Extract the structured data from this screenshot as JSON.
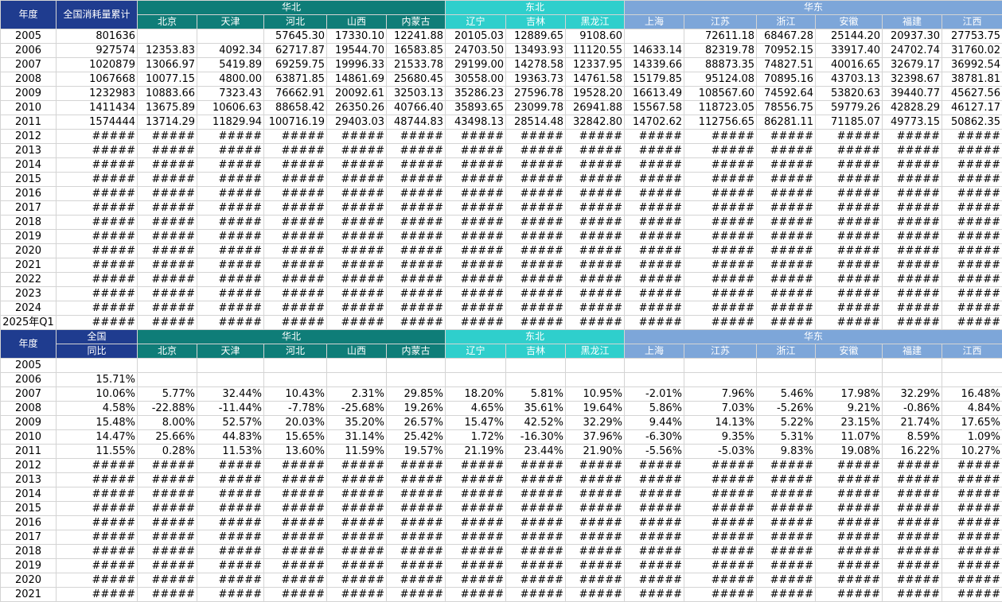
{
  "sheet": {
    "top_left_header": "年度",
    "nat_header_top": "全国消耗量累计",
    "nat_header_bottom_1": "全国",
    "nat_header_bottom_2": "同比",
    "regions": [
      {
        "name": "华北",
        "color": "#0f7d78",
        "span": 5
      },
      {
        "name": "东北",
        "color": "#2fcfcc",
        "span": 3
      },
      {
        "name": "华东",
        "color": "#7da6d9",
        "span": 7
      }
    ],
    "provinces": [
      "北京",
      "天津",
      "河北",
      "山西",
      "内蒙古",
      "辽宁",
      "吉林",
      "黑龙江",
      "上海",
      "江苏",
      "浙江",
      "安徽",
      "福建",
      "江西"
    ],
    "top_rows": [
      {
        "year": "2005",
        "values": [
          "801636",
          "",
          "",
          "57645.30",
          "17330.10",
          "12241.88",
          "20105.03",
          "12889.65",
          "9108.60",
          "",
          "72611.18",
          "68467.28",
          "25144.20",
          "20937.30",
          "27753.75"
        ]
      },
      {
        "year": "2006",
        "values": [
          "927574",
          "12353.83",
          "4092.34",
          "62717.87",
          "19544.70",
          "16583.85",
          "24703.50",
          "13493.93",
          "11120.55",
          "14633.14",
          "82319.78",
          "70952.15",
          "33917.40",
          "24702.74",
          "31760.02"
        ]
      },
      {
        "year": "2007",
        "values": [
          "1020879",
          "13066.97",
          "5419.89",
          "69259.75",
          "19996.33",
          "21533.78",
          "29199.00",
          "14278.58",
          "12337.95",
          "14339.66",
          "88873.35",
          "74827.51",
          "40016.65",
          "32679.17",
          "36992.54"
        ]
      },
      {
        "year": "2008",
        "values": [
          "1067668",
          "10077.15",
          "4800.00",
          "63871.85",
          "14861.69",
          "25680.45",
          "30558.00",
          "19363.73",
          "14761.58",
          "15179.85",
          "95124.08",
          "70895.16",
          "43703.13",
          "32398.67",
          "38781.81"
        ]
      },
      {
        "year": "2009",
        "values": [
          "1232983",
          "10883.66",
          "7323.43",
          "76662.91",
          "20092.61",
          "32503.13",
          "35286.23",
          "27596.78",
          "19528.20",
          "16613.49",
          "108567.60",
          "74592.64",
          "53820.63",
          "39440.77",
          "45627.56"
        ]
      },
      {
        "year": "2010",
        "values": [
          "1411434",
          "13675.89",
          "10606.63",
          "88658.42",
          "26350.26",
          "40766.40",
          "35893.65",
          "23099.78",
          "26941.88",
          "15567.58",
          "118723.05",
          "78556.75",
          "59779.26",
          "42828.29",
          "46127.17"
        ]
      },
      {
        "year": "2011",
        "values": [
          "1574444",
          "13714.29",
          "11829.94",
          "100716.19",
          "29403.03",
          "48744.83",
          "43498.13",
          "28514.48",
          "32842.80",
          "14702.62",
          "112756.65",
          "86281.11",
          "71185.07",
          "49773.15",
          "50862.35"
        ]
      },
      {
        "year": "2012",
        "values": [
          "#####",
          "#####",
          "#####",
          "#####",
          "#####",
          "#####",
          "#####",
          "#####",
          "#####",
          "#####",
          "#####",
          "#####",
          "#####",
          "#####",
          "#####"
        ]
      },
      {
        "year": "2013",
        "values": [
          "#####",
          "#####",
          "#####",
          "#####",
          "#####",
          "#####",
          "#####",
          "#####",
          "#####",
          "#####",
          "#####",
          "#####",
          "#####",
          "#####",
          "#####"
        ]
      },
      {
        "year": "2014",
        "values": [
          "#####",
          "#####",
          "#####",
          "#####",
          "#####",
          "#####",
          "#####",
          "#####",
          "#####",
          "#####",
          "#####",
          "#####",
          "#####",
          "#####",
          "#####"
        ]
      },
      {
        "year": "2015",
        "values": [
          "#####",
          "#####",
          "#####",
          "#####",
          "#####",
          "#####",
          "#####",
          "#####",
          "#####",
          "#####",
          "#####",
          "#####",
          "#####",
          "#####",
          "#####"
        ]
      },
      {
        "year": "2016",
        "values": [
          "#####",
          "#####",
          "#####",
          "#####",
          "#####",
          "#####",
          "#####",
          "#####",
          "#####",
          "#####",
          "#####",
          "#####",
          "#####",
          "#####",
          "#####"
        ]
      },
      {
        "year": "2017",
        "values": [
          "#####",
          "#####",
          "#####",
          "#####",
          "#####",
          "#####",
          "#####",
          "#####",
          "#####",
          "#####",
          "#####",
          "#####",
          "#####",
          "#####",
          "#####"
        ]
      },
      {
        "year": "2018",
        "values": [
          "#####",
          "#####",
          "#####",
          "#####",
          "#####",
          "#####",
          "#####",
          "#####",
          "#####",
          "#####",
          "#####",
          "#####",
          "#####",
          "#####",
          "#####"
        ]
      },
      {
        "year": "2019",
        "values": [
          "#####",
          "#####",
          "#####",
          "#####",
          "#####",
          "#####",
          "#####",
          "#####",
          "#####",
          "#####",
          "#####",
          "#####",
          "#####",
          "#####",
          "#####"
        ]
      },
      {
        "year": "2020",
        "values": [
          "#####",
          "#####",
          "#####",
          "#####",
          "#####",
          "#####",
          "#####",
          "#####",
          "#####",
          "#####",
          "#####",
          "#####",
          "#####",
          "#####",
          "#####"
        ]
      },
      {
        "year": "2021",
        "values": [
          "#####",
          "#####",
          "#####",
          "#####",
          "#####",
          "#####",
          "#####",
          "#####",
          "#####",
          "#####",
          "#####",
          "#####",
          "#####",
          "#####",
          "#####"
        ]
      },
      {
        "year": "2022",
        "values": [
          "#####",
          "#####",
          "#####",
          "#####",
          "#####",
          "#####",
          "#####",
          "#####",
          "#####",
          "#####",
          "#####",
          "#####",
          "#####",
          "#####",
          "#####"
        ]
      },
      {
        "year": "2023",
        "values": [
          "#####",
          "#####",
          "#####",
          "#####",
          "#####",
          "#####",
          "#####",
          "#####",
          "#####",
          "#####",
          "#####",
          "#####",
          "#####",
          "#####",
          "#####"
        ]
      },
      {
        "year": "2024",
        "values": [
          "#####",
          "#####",
          "#####",
          "#####",
          "#####",
          "#####",
          "#####",
          "#####",
          "#####",
          "#####",
          "#####",
          "#####",
          "#####",
          "#####",
          "#####"
        ]
      },
      {
        "year": "2025年Q1",
        "values": [
          "#####",
          "#####",
          "#####",
          "#####",
          "#####",
          "#####",
          "#####",
          "#####",
          "#####",
          "#####",
          "#####",
          "#####",
          "#####",
          "#####",
          "#####"
        ]
      }
    ],
    "bottom_rows": [
      {
        "year": "2005",
        "values": [
          "",
          "",
          "",
          "",
          "",
          "",
          "",
          "",
          "",
          "",
          "",
          "",
          "",
          "",
          ""
        ]
      },
      {
        "year": "2006",
        "values": [
          "15.71%",
          "",
          "",
          "",
          "",
          "",
          "",
          "",
          "",
          "",
          "",
          "",
          "",
          "",
          ""
        ]
      },
      {
        "year": "2007",
        "values": [
          "10.06%",
          "5.77%",
          "32.44%",
          "10.43%",
          "2.31%",
          "29.85%",
          "18.20%",
          "5.81%",
          "10.95%",
          "-2.01%",
          "7.96%",
          "5.46%",
          "17.98%",
          "32.29%",
          "16.48%"
        ]
      },
      {
        "year": "2008",
        "values": [
          "4.58%",
          "-22.88%",
          "-11.44%",
          "-7.78%",
          "-25.68%",
          "19.26%",
          "4.65%",
          "35.61%",
          "19.64%",
          "5.86%",
          "7.03%",
          "-5.26%",
          "9.21%",
          "-0.86%",
          "4.84%"
        ]
      },
      {
        "year": "2009",
        "values": [
          "15.48%",
          "8.00%",
          "52.57%",
          "20.03%",
          "35.20%",
          "26.57%",
          "15.47%",
          "42.52%",
          "32.29%",
          "9.44%",
          "14.13%",
          "5.22%",
          "23.15%",
          "21.74%",
          "17.65%"
        ]
      },
      {
        "year": "2010",
        "values": [
          "14.47%",
          "25.66%",
          "44.83%",
          "15.65%",
          "31.14%",
          "25.42%",
          "1.72%",
          "-16.30%",
          "37.96%",
          "-6.30%",
          "9.35%",
          "5.31%",
          "11.07%",
          "8.59%",
          "1.09%"
        ]
      },
      {
        "year": "2011",
        "values": [
          "11.55%",
          "0.28%",
          "11.53%",
          "13.60%",
          "11.59%",
          "19.57%",
          "21.19%",
          "23.44%",
          "21.90%",
          "-5.56%",
          "-5.03%",
          "9.83%",
          "19.08%",
          "16.22%",
          "10.27%"
        ]
      },
      {
        "year": "2012",
        "values": [
          "#####",
          "#####",
          "#####",
          "#####",
          "#####",
          "#####",
          "#####",
          "#####",
          "#####",
          "#####",
          "#####",
          "#####",
          "#####",
          "#####",
          "#####"
        ]
      },
      {
        "year": "2013",
        "values": [
          "#####",
          "#####",
          "#####",
          "#####",
          "#####",
          "#####",
          "#####",
          "#####",
          "#####",
          "#####",
          "#####",
          "#####",
          "#####",
          "#####",
          "#####"
        ]
      },
      {
        "year": "2014",
        "values": [
          "#####",
          "#####",
          "#####",
          "#####",
          "#####",
          "#####",
          "#####",
          "#####",
          "#####",
          "#####",
          "#####",
          "#####",
          "#####",
          "#####",
          "#####"
        ]
      },
      {
        "year": "2015",
        "values": [
          "#####",
          "#####",
          "#####",
          "#####",
          "#####",
          "#####",
          "#####",
          "#####",
          "#####",
          "#####",
          "#####",
          "#####",
          "#####",
          "#####",
          "#####"
        ]
      },
      {
        "year": "2016",
        "values": [
          "#####",
          "#####",
          "#####",
          "#####",
          "#####",
          "#####",
          "#####",
          "#####",
          "#####",
          "#####",
          "#####",
          "#####",
          "#####",
          "#####",
          "#####"
        ]
      },
      {
        "year": "2017",
        "values": [
          "#####",
          "#####",
          "#####",
          "#####",
          "#####",
          "#####",
          "#####",
          "#####",
          "#####",
          "#####",
          "#####",
          "#####",
          "#####",
          "#####",
          "#####"
        ]
      },
      {
        "year": "2018",
        "values": [
          "#####",
          "#####",
          "#####",
          "#####",
          "#####",
          "#####",
          "#####",
          "#####",
          "#####",
          "#####",
          "#####",
          "#####",
          "#####",
          "#####",
          "#####"
        ]
      },
      {
        "year": "2019",
        "values": [
          "#####",
          "#####",
          "#####",
          "#####",
          "#####",
          "#####",
          "#####",
          "#####",
          "#####",
          "#####",
          "#####",
          "#####",
          "#####",
          "#####",
          "#####"
        ]
      },
      {
        "year": "2020",
        "values": [
          "#####",
          "#####",
          "#####",
          "#####",
          "#####",
          "#####",
          "#####",
          "#####",
          "#####",
          "#####",
          "#####",
          "#####",
          "#####",
          "#####",
          "#####"
        ]
      },
      {
        "year": "2021",
        "values": [
          "#####",
          "#####",
          "#####",
          "#####",
          "#####",
          "#####",
          "#####",
          "#####",
          "#####",
          "#####",
          "#####",
          "#####",
          "#####",
          "#####",
          "#####"
        ]
      }
    ]
  }
}
